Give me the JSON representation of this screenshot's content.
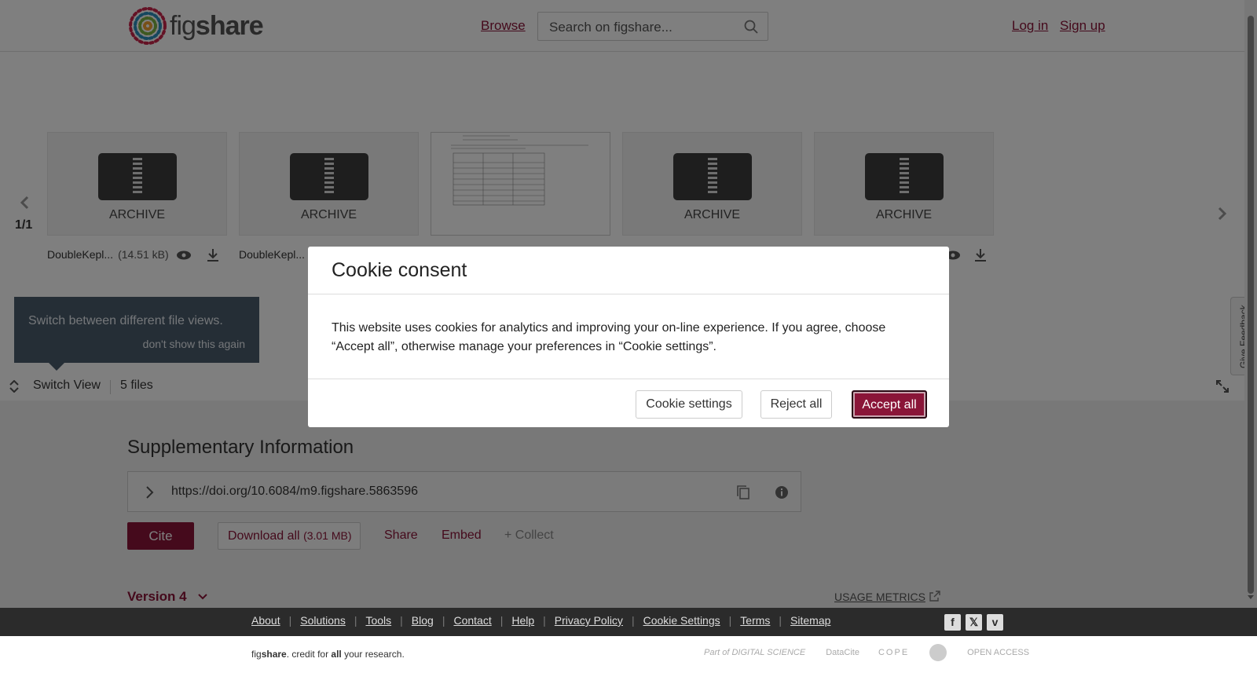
{
  "header": {
    "logo_text_light": "fig",
    "logo_text_bold": "share",
    "browse": "Browse",
    "search_placeholder": "Search on figshare...",
    "login": "Log in",
    "signup": "Sign up"
  },
  "carousel": {
    "pager": "1/1",
    "tiles": [
      {
        "label": "ARCHIVE",
        "type": "archive"
      },
      {
        "label": "ARCHIVE",
        "type": "archive"
      },
      {
        "label": "",
        "type": "document"
      },
      {
        "label": "ARCHIVE",
        "type": "archive"
      },
      {
        "label": "ARCHIVE",
        "type": "archive"
      }
    ],
    "files": [
      {
        "name": "DoubleKepl...",
        "size": "(14.51 kB)"
      },
      {
        "name": "DoubleKepl..."
      }
    ]
  },
  "tooltip": {
    "text": "Switch between different file views.",
    "dismiss": "don't show this again"
  },
  "switchbar": {
    "switch_view": "Switch View",
    "files_count": "5 files"
  },
  "supplementary": {
    "title": "Supplementary Information",
    "doi": "https://doi.org/10.6084/m9.figshare.5863596",
    "cite": "Cite",
    "download_all": "Download all",
    "download_size": "(3.01 MB)",
    "share": "Share",
    "embed": "Embed",
    "collect": "+ Collect",
    "version": "Version 4",
    "usage_metrics": "USAGE METRICS"
  },
  "footer": {
    "links": [
      "About",
      "Solutions",
      "Tools",
      "Blog",
      "Contact",
      "Help",
      "Privacy Policy",
      "Cookie Settings",
      "Terms",
      "Sitemap"
    ],
    "credit_pre": "fig",
    "credit_bold": "share",
    "credit_mid": ". credit for ",
    "credit_all": "all",
    "credit_post": " your research.",
    "partners": [
      "Part of DIGITAL SCIENCE",
      "DataCite",
      "COPE",
      "",
      "OPEN ACCESS"
    ]
  },
  "feedback": "Give Feedback",
  "modal": {
    "title": "Cookie consent",
    "body": "This website uses cookies for analytics and improving your on-line experience. If you agree, choose “Accept all”, otherwise manage your preferences in “Cookie settings”.",
    "settings": "Cookie settings",
    "reject": "Reject all",
    "accept": "Accept all"
  },
  "colors": {
    "brand": "#8a1538",
    "footer_bg": "#2b2b2b",
    "tooltip_bg": "#4b5d6c"
  },
  "icons": {
    "search": "search-icon",
    "nav_left": "chevron-left-icon",
    "nav_right": "chevron-right-icon",
    "preview": "eye-icon",
    "download": "download-icon",
    "switch": "switch-view-icon",
    "expand": "expand-icon",
    "doi_toggle": "chevron-right-icon",
    "copy": "copy-icon",
    "info": "info-icon",
    "version": "chevron-down-icon",
    "external": "external-link-icon",
    "social": [
      "facebook-icon",
      "x-icon",
      "vimeo-icon"
    ]
  }
}
